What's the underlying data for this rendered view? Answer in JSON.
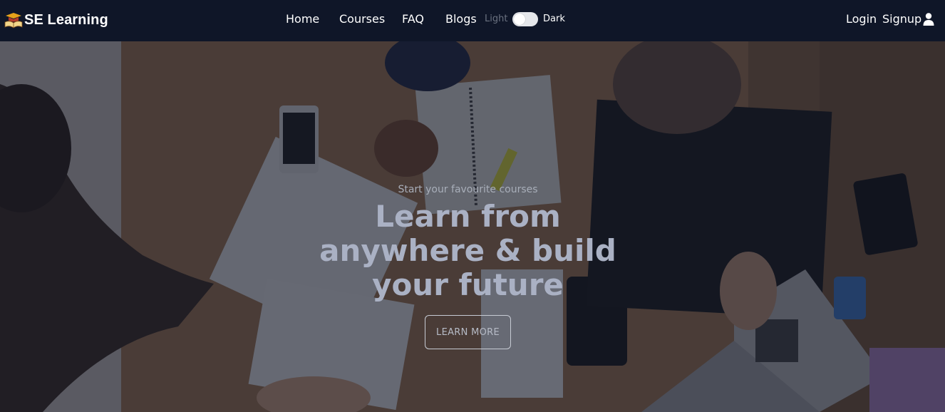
{
  "brand": {
    "name": "SE Learning",
    "logo_icon": "graduation-book-icon"
  },
  "nav": {
    "links": [
      "Home",
      "Courses",
      "FAQ",
      "Blogs"
    ],
    "theme": {
      "light_label": "Light",
      "dark_label": "Dark"
    },
    "auth": {
      "login": "Login",
      "signup": "Signup",
      "icon": "user-icon"
    }
  },
  "hero": {
    "subtitle": "Start your favourite courses",
    "title_lines": [
      "Learn from",
      "anywhere & build",
      "your future"
    ],
    "cta": "LEARN MORE"
  },
  "colors": {
    "navbar_bg": "#0f1628",
    "text": "#ffffff",
    "muted": "#6b7280"
  }
}
